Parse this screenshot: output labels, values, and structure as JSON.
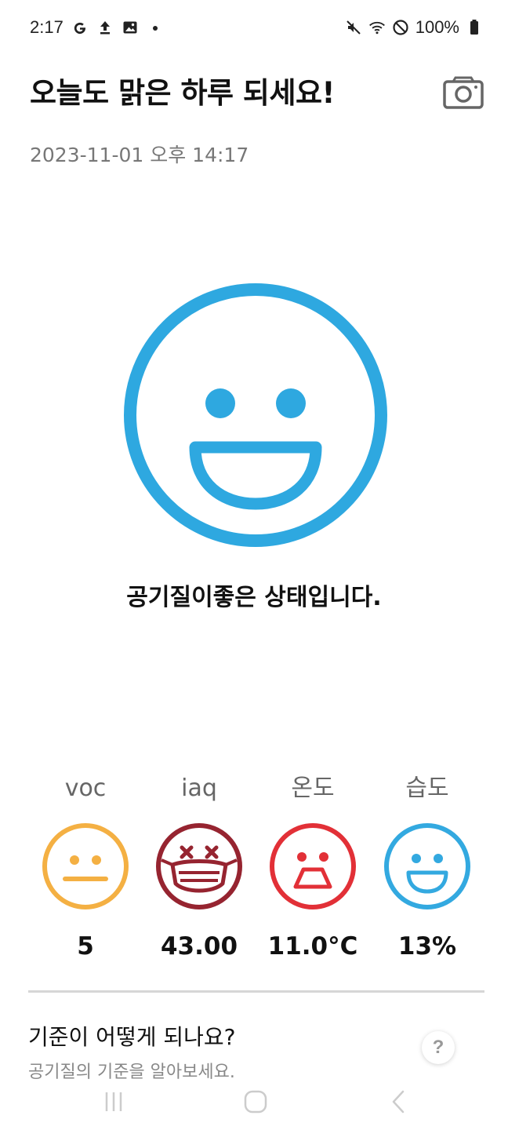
{
  "status_bar": {
    "time": "2:17",
    "battery_text": "100%",
    "left_icons": [
      "google-icon",
      "upload-icon",
      "image-icon",
      "dot-icon"
    ],
    "right_icons": [
      "mute-icon",
      "wifi-icon",
      "no-disturb-icon",
      "battery-icon"
    ]
  },
  "header": {
    "title": "오늘도 맑은 하루 되세요!",
    "datetime": "2023-11-01 오후 14:17",
    "camera_icon": "camera-icon"
  },
  "main": {
    "face_icon": "big-smile-face-icon",
    "message": "공기질이좋은 상태입니다."
  },
  "metrics": [
    {
      "label": "voc",
      "value": "5",
      "icon": "neutral-face-icon",
      "color": "#F4B043"
    },
    {
      "label": "iaq",
      "value": "43.00",
      "icon": "mask-dizzy-face-icon",
      "color": "#962430"
    },
    {
      "label": "온도",
      "value": "11.0°C",
      "icon": "shocked-face-icon",
      "color": "#E23037"
    },
    {
      "label": "습도",
      "value": "13%",
      "icon": "smile-face-icon",
      "color": "#33A9E0"
    }
  ],
  "help": {
    "title": "기준이 어떻게 되나요?",
    "subtitle": "공기질의 기준을 알아보세요.",
    "button_glyph": "?"
  },
  "nav_bar": {
    "buttons": [
      "recent-apps-icon",
      "home-icon",
      "back-icon"
    ]
  },
  "colors": {
    "accent_blue": "#2EA8E0",
    "text_dark": "#111111",
    "text_muted": "#777777",
    "divider": "#D6D6D6"
  }
}
